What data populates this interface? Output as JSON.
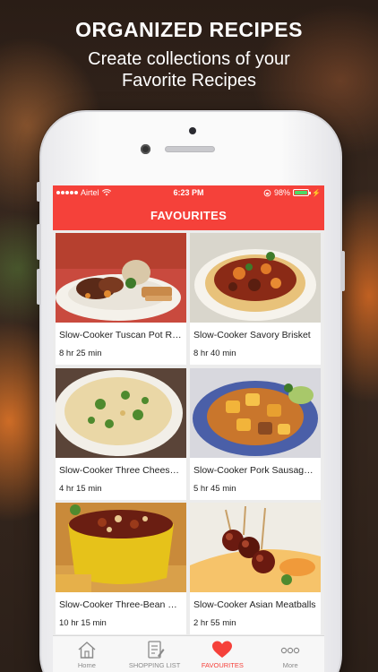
{
  "promo": {
    "title": "ORGANIZED RECIPES",
    "subtitle": "Create collections of your Favorite Recipes"
  },
  "status_bar": {
    "carrier": "Airtel",
    "time": "6:23 PM",
    "battery": "98%"
  },
  "nav": {
    "title": "FAVOURITES"
  },
  "recipes": [
    {
      "title": "Slow-Cooker Tuscan Pot Roast",
      "time": "8 hr 25 min"
    },
    {
      "title": "Slow-Cooker Savory Brisket",
      "time": "8 hr 40 min"
    },
    {
      "title": "Slow-Cooker Three Cheese Soup",
      "time": "4 hr 15 min"
    },
    {
      "title": "Slow-Cooker Pork Sausage Stew",
      "time": "5 hr 45 min"
    },
    {
      "title": "Slow-Cooker Three-Bean Chili",
      "time": "10 hr 15 min"
    },
    {
      "title": "Slow-Cooker Asian Meatballs",
      "time": "2 hr 55 min"
    }
  ],
  "tabs": [
    {
      "label": "Home",
      "icon": "home-icon"
    },
    {
      "label": "SHOPPING LIST",
      "icon": "shopping-list-icon"
    },
    {
      "label": "FAVOURITES",
      "icon": "heart-icon"
    },
    {
      "label": "More",
      "icon": "more-icon"
    }
  ],
  "colors": {
    "accent": "#f5413a",
    "background": "#ececec"
  }
}
